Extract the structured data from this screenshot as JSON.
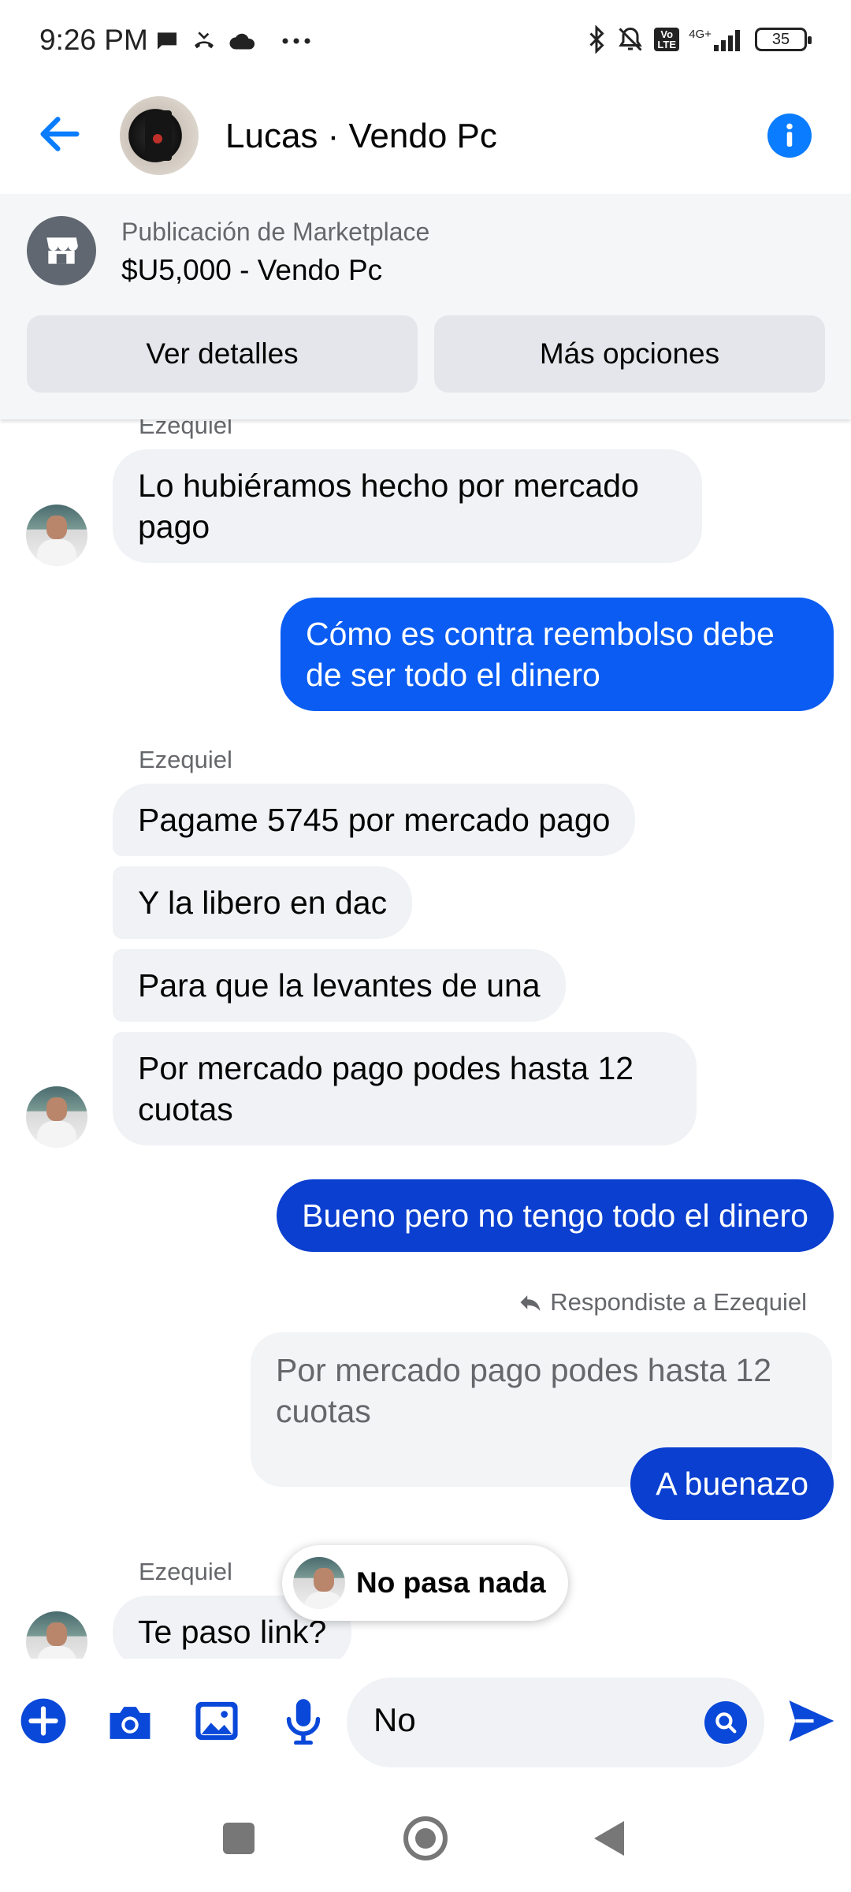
{
  "status_bar": {
    "time": "9:26 PM",
    "battery": "35",
    "icons": [
      "message-icon",
      "missed-call-icon",
      "cloud-icon",
      "more-dots-icon",
      "bluetooth-icon",
      "mute-icon",
      "volte-icon",
      "signal-4g-icon",
      "battery-icon"
    ],
    "network_label": "4G+",
    "volte_label": "Vo LTE"
  },
  "header": {
    "title": "Lucas · Vendo Pc",
    "back_icon": "arrow-left-icon",
    "info_icon": "info-icon",
    "accent": "#0a7cff"
  },
  "marketplace": {
    "subtitle": "Publicación de Marketplace",
    "title": "$U5,000 - Vendo Pc",
    "details_button": "Ver detalles",
    "options_button": "Más opciones",
    "icon": "storefront-icon"
  },
  "messages": {
    "sender_top": "Ezequiel",
    "m1": "Lo hubiéramos hecho por mercado pago",
    "m2": "Cómo es contra reembolso debe de ser todo el dinero",
    "sender_2": "Ezequiel",
    "m3": "Pagame 5745 por mercado pago",
    "m4": "Y la libero en dac",
    "m5": "Para que la levantes de una",
    "m6": "Por mercado pago podes hasta 12 cuotas",
    "m7": "Bueno pero no tengo todo el dinero",
    "reply_label": "Respondiste a Ezequiel",
    "quoted": "Por mercado pago podes hasta 12 cuotas",
    "m8": "A buenazo",
    "sender_3": "Ezequiel",
    "m9": "Te paso link?"
  },
  "toast": {
    "text": "No pasa nada"
  },
  "composer": {
    "input_value": "No",
    "icons": [
      "plus-icon",
      "camera-icon",
      "image-icon",
      "microphone-icon",
      "search-icon",
      "send-icon"
    ],
    "accent": "#0a48d9"
  },
  "colors": {
    "outgoing_bubble_light": "#0a5cf2",
    "outgoing_bubble_dark": "#0a3fd0",
    "incoming_bubble": "#f0f2f5"
  }
}
